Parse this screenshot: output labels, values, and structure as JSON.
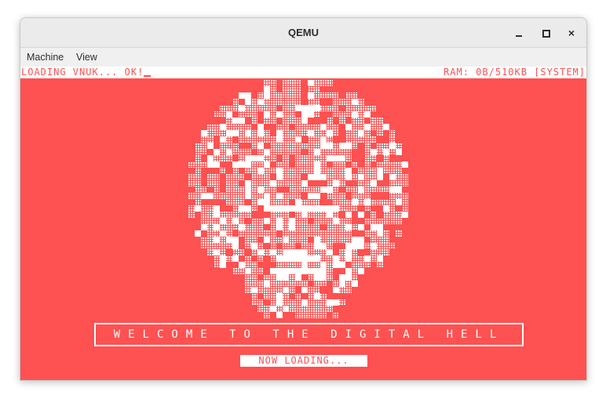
{
  "window": {
    "title": "QEMU",
    "controls": {
      "minimize_icon": "minimize-icon",
      "maximize_icon": "maximize-icon",
      "close_icon": "close-icon",
      "close_glyph": "×"
    }
  },
  "menu": {
    "items": [
      {
        "label": "Machine"
      },
      {
        "label": "View"
      }
    ]
  },
  "vm_screen": {
    "background": "#fe5151",
    "foreground": "#ffffff",
    "status_left": "LOADING VNUK... OK!",
    "status_right": "RAM: 0B/510KB [SYSTEM]",
    "welcome": "WELCOME TO THE DIGITAL HELL",
    "loading": "NOW LOADING..."
  }
}
